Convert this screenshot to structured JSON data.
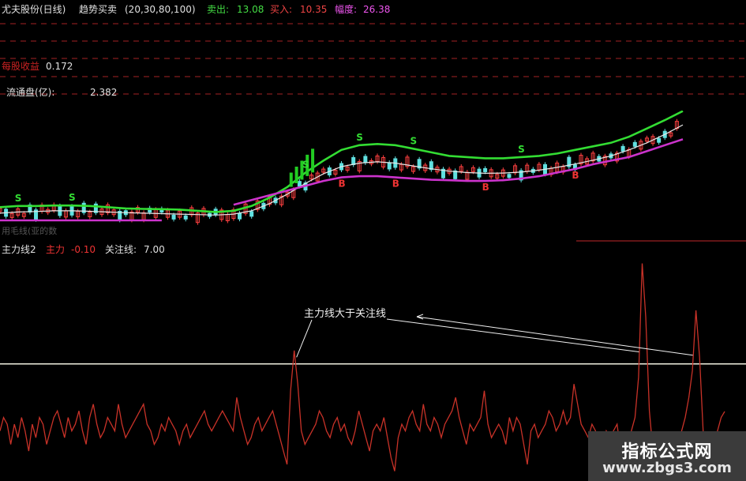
{
  "header": {
    "stock": "尤夫股份(日线)",
    "indicator": "趋势买卖",
    "params": "(20,30,80,100)",
    "sell_label": "卖出:",
    "sell_value": "13.08",
    "buy_label": "买入:",
    "buy_value": "10.35",
    "range_label": "幅度:",
    "range_value": "26.38"
  },
  "info": {
    "eps_label": "每股收益",
    "eps_value": "0.172",
    "float_label": "流通盘(亿):",
    "float_value": "2.382"
  },
  "faded_text": "用毛线(亚的数",
  "sub_header": {
    "name": "主力线2",
    "main_label": "主力",
    "main_value": "-0.10",
    "focus_label": "关注线:",
    "focus_value": "7.00"
  },
  "annotation": "主力线大于关注线",
  "colors": {
    "up_green": "#33dd33",
    "ma_white": "#e8e8e8",
    "support_magenta": "#cc33cc",
    "main_red": "#c83228",
    "focus_line": "#f0f0e0",
    "dashes": "#c0282a"
  },
  "watermark": {
    "title": "指标公式网",
    "url": "www.zbgs3.com"
  },
  "chart_data": [
    {
      "type": "line",
      "panel": "main",
      "title": "趋势买卖",
      "series": [
        {
          "name": "upper_band",
          "color": "#33dd33",
          "values": [
            9.05,
            9.1,
            9.1,
            9.12,
            9.12,
            9.1,
            9.05,
            9.0,
            8.98,
            8.97,
            8.95,
            8.9,
            8.85,
            8.9,
            9.1,
            9.45,
            9.9,
            10.5,
            11.0,
            11.45,
            11.65,
            11.7,
            11.65,
            11.5,
            11.35,
            11.2,
            11.15,
            11.1,
            11.1,
            11.15,
            11.2,
            11.3,
            11.45,
            11.6,
            11.75,
            12.0,
            12.35,
            12.7,
            13.08
          ]
        },
        {
          "name": "middle_line",
          "color": "#e8e8e8",
          "values": [
            8.8,
            8.85,
            8.87,
            8.9,
            8.9,
            8.88,
            8.85,
            8.82,
            8.8,
            8.78,
            8.76,
            8.74,
            8.72,
            8.76,
            8.9,
            9.2,
            9.6,
            10.05,
            10.45,
            10.75,
            10.9,
            10.95,
            10.9,
            10.78,
            10.66,
            10.56,
            10.5,
            10.47,
            10.48,
            10.52,
            10.6,
            10.72,
            10.86,
            11.02,
            11.2,
            11.45,
            11.75,
            12.1,
            12.5
          ]
        },
        {
          "name": "lower_band",
          "color": "#cc33cc",
          "values": [
            8.5,
            8.5,
            8.5,
            8.5,
            8.5,
            8.5,
            8.5,
            8.5,
            8.5,
            8.5,
            null,
            null,
            null,
            9.15,
            9.35,
            9.55,
            9.75,
            9.95,
            10.15,
            10.3,
            10.35,
            10.35,
            10.3,
            10.25,
            10.2,
            10.18,
            10.15,
            10.15,
            10.18,
            10.25,
            10.35,
            10.5,
            10.65,
            10.85,
            11.0,
            11.15,
            11.4,
            11.65,
            11.9
          ]
        }
      ],
      "signals": [
        {
          "type": "S",
          "index": 1
        },
        {
          "type": "S",
          "index": 4
        },
        {
          "type": "S",
          "index": 17
        },
        {
          "type": "S",
          "index": 20
        },
        {
          "type": "S",
          "index": 23
        },
        {
          "type": "S",
          "index": 29
        },
        {
          "type": "B",
          "index": 19
        },
        {
          "type": "B",
          "index": 22
        },
        {
          "type": "B",
          "index": 27
        },
        {
          "type": "B",
          "index": 32
        }
      ]
    },
    {
      "type": "line",
      "panel": "sub",
      "title": "主力线2",
      "series": [
        {
          "name": "主力",
          "color": "#c83228",
          "values": [
            -3,
            -1,
            -2,
            -5,
            -2,
            -4,
            -1,
            -3,
            -6,
            -2,
            -4,
            -1,
            -2,
            -5,
            -3,
            -1,
            0,
            -2,
            -4,
            -1,
            -3,
            -2,
            0,
            -3,
            -5,
            -1,
            1,
            -2,
            -4,
            -3,
            -1,
            -2,
            -3,
            1,
            -2,
            -4,
            -3,
            -2,
            -1,
            0,
            1,
            -2,
            -3,
            -5,
            -4,
            -2,
            -3,
            -1,
            -2,
            -3,
            -5,
            -3,
            -2,
            -4,
            -3,
            -2,
            -1,
            0,
            -2,
            -3,
            -2,
            -1,
            0,
            -1,
            -2,
            -3,
            2,
            -1,
            -3,
            -5,
            -4,
            -2,
            -1,
            -3,
            -2,
            -1,
            0,
            -2,
            -4,
            -6,
            -8,
            3,
            9,
            4,
            -3,
            -5,
            -4,
            -3,
            -2,
            0,
            -1,
            -3,
            -4,
            -2,
            -1,
            -3,
            -2,
            -4,
            -5,
            -3,
            0,
            -2,
            -4,
            -6,
            -3,
            -2,
            -3,
            -1,
            -4,
            -7,
            -9,
            -4,
            -2,
            -3,
            -1,
            0,
            -2,
            -3,
            1,
            -2,
            -3,
            -1,
            -2,
            -4,
            -2,
            -1,
            0,
            2,
            -1,
            -3,
            -5,
            -2,
            -3,
            -2,
            -1,
            3,
            -2,
            -4,
            -3,
            -2,
            -3,
            -5,
            -1,
            -3,
            -1,
            -2,
            -5,
            -8,
            -3,
            -2,
            -4,
            -3,
            -2,
            0,
            -1,
            -3,
            -2,
            0,
            -2,
            -1,
            4,
            1,
            -2,
            -3,
            -4,
            -2,
            -3,
            -5,
            -6,
            -3,
            -4,
            -3,
            -2,
            -6,
            -4,
            -5,
            -3,
            -1,
            5,
            22,
            14,
            0,
            -6,
            -8,
            -9,
            -7,
            -6,
            -7,
            -6,
            -4,
            -3,
            -1,
            2,
            6,
            15,
            8,
            -3,
            -6,
            -8,
            -5,
            -3,
            -1,
            -0.1
          ]
        },
        {
          "name": "关注线",
          "color": "#f0f0e0",
          "constant": 7.0
        }
      ],
      "annotation": "主力线大于关注线"
    }
  ]
}
